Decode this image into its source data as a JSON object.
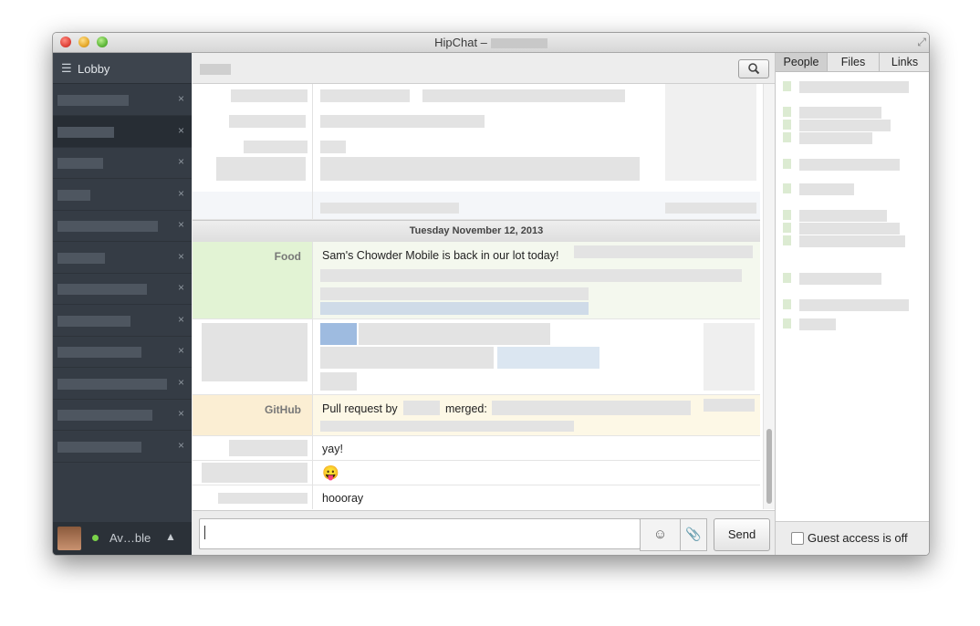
{
  "window": {
    "title": "HipChat –"
  },
  "sidebar": {
    "lobby_label": "Lobby",
    "user_status": "Av…ble",
    "room_close_glyph": "×",
    "room_count": 12
  },
  "main": {
    "date_separator": "Tuesday November 12, 2013",
    "messages": [
      {
        "sender": "Food",
        "text": "Sam's Chowder Mobile is back in our lot today!",
        "bg": "#e2f3d4"
      },
      {
        "sender": "GitHub",
        "text_prefix": "Pull request by",
        "text_mid": "merged:",
        "bg": "#fbeed3"
      },
      {
        "text": "yay!"
      },
      {
        "emoji": "😛"
      },
      {
        "text": "hoooray"
      }
    ]
  },
  "composer": {
    "emoji_glyph": "☺",
    "attach_glyph": "📎",
    "send_label": "Send"
  },
  "right_panel": {
    "tabs": [
      "People",
      "Files",
      "Links"
    ],
    "active_tab": "People",
    "guest_access_label": "Guest access is off"
  },
  "icons": {
    "lobby": "list-icon",
    "search": "search-icon",
    "emoji": "emoji-icon",
    "attach": "paperclip-icon",
    "fullscreen": "fullscreen-icon"
  }
}
